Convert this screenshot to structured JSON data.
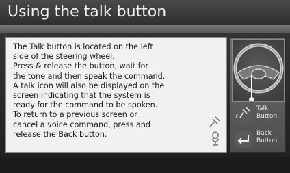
{
  "title": "Using the talk button",
  "body_text": "The Talk button is located on the left\nside of the steering wheel.\nPress & release the button, wait for\nthe tone and then speak the command.\nA talk icon will also be displayed on the\nscreen indicating that the system is\nready for the command to be spoken.\nTo return to a previous screen or\ncancel a voice command, press and\nrelease the Back button.",
  "side_buttons": [
    {
      "label": "Talk\nButton",
      "icon": "talk-icon"
    },
    {
      "label": "Back\nButton",
      "icon": "back-icon"
    }
  ],
  "colors": {
    "panel": "#f1f1ef",
    "title_text": "#f2f2f2",
    "frame": "#303030"
  }
}
